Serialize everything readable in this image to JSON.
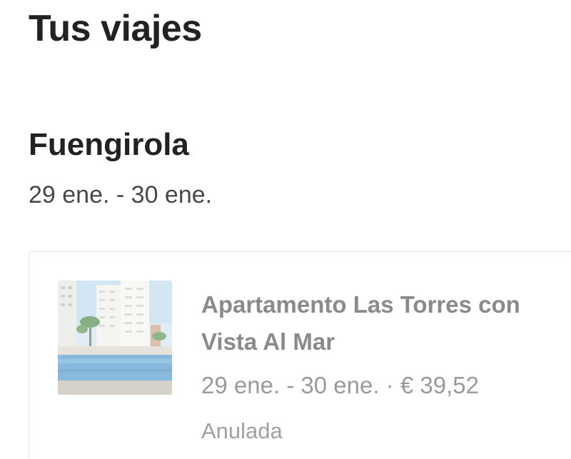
{
  "page": {
    "title": "Tus viajes"
  },
  "trip": {
    "destination": "Fuengirola",
    "dates": "29 ene. - 30 ene."
  },
  "reservation": {
    "listing_name": "Apartamento Las Torres con Vista Al Mar",
    "dates": "29 ene. - 30 ene.",
    "separator": "·",
    "price": "€ 39,52",
    "status": "Anulada",
    "thumbnail": "apartment-building-with-pool-photo"
  }
}
